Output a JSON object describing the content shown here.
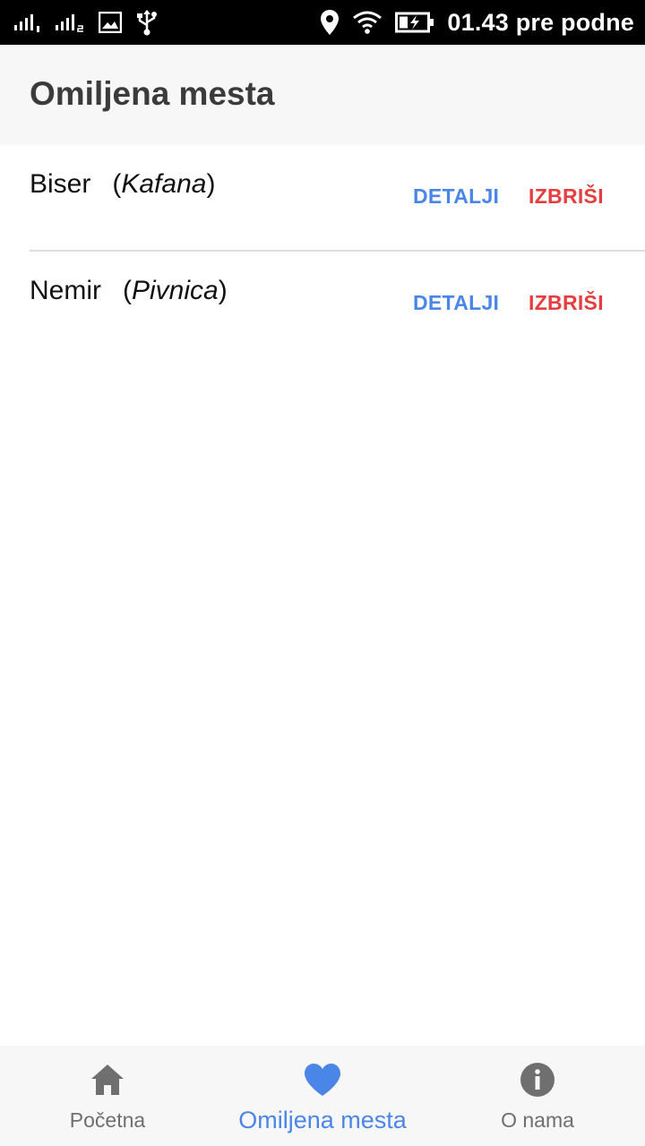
{
  "status_bar": {
    "time": "01.43 pre podne",
    "icons": [
      "signal-sim1-icon",
      "signal-sim2-icon",
      "image-icon",
      "usb-icon",
      "location-icon",
      "wifi-icon",
      "battery-charging-icon"
    ]
  },
  "header": {
    "title": "Omiljena mesta"
  },
  "favorites": [
    {
      "name": "Biser",
      "type": "Kafana",
      "details_label": "DETALJI",
      "delete_label": "IZBRIŠI"
    },
    {
      "name": "Nemir",
      "type": "Pivnica",
      "details_label": "DETALJI",
      "delete_label": "IZBRIŠI"
    }
  ],
  "bottom_nav": {
    "tabs": [
      {
        "label": "Početna",
        "icon": "home-icon",
        "active": false
      },
      {
        "label": "Omiljena mesta",
        "icon": "heart-icon",
        "active": true
      },
      {
        "label": "O nama",
        "icon": "info-icon",
        "active": false
      }
    ]
  },
  "colors": {
    "accent": "#4a86e8",
    "delete": "#e53e3e",
    "status_bar": "#000000",
    "header_bg": "#f7f7f7"
  }
}
